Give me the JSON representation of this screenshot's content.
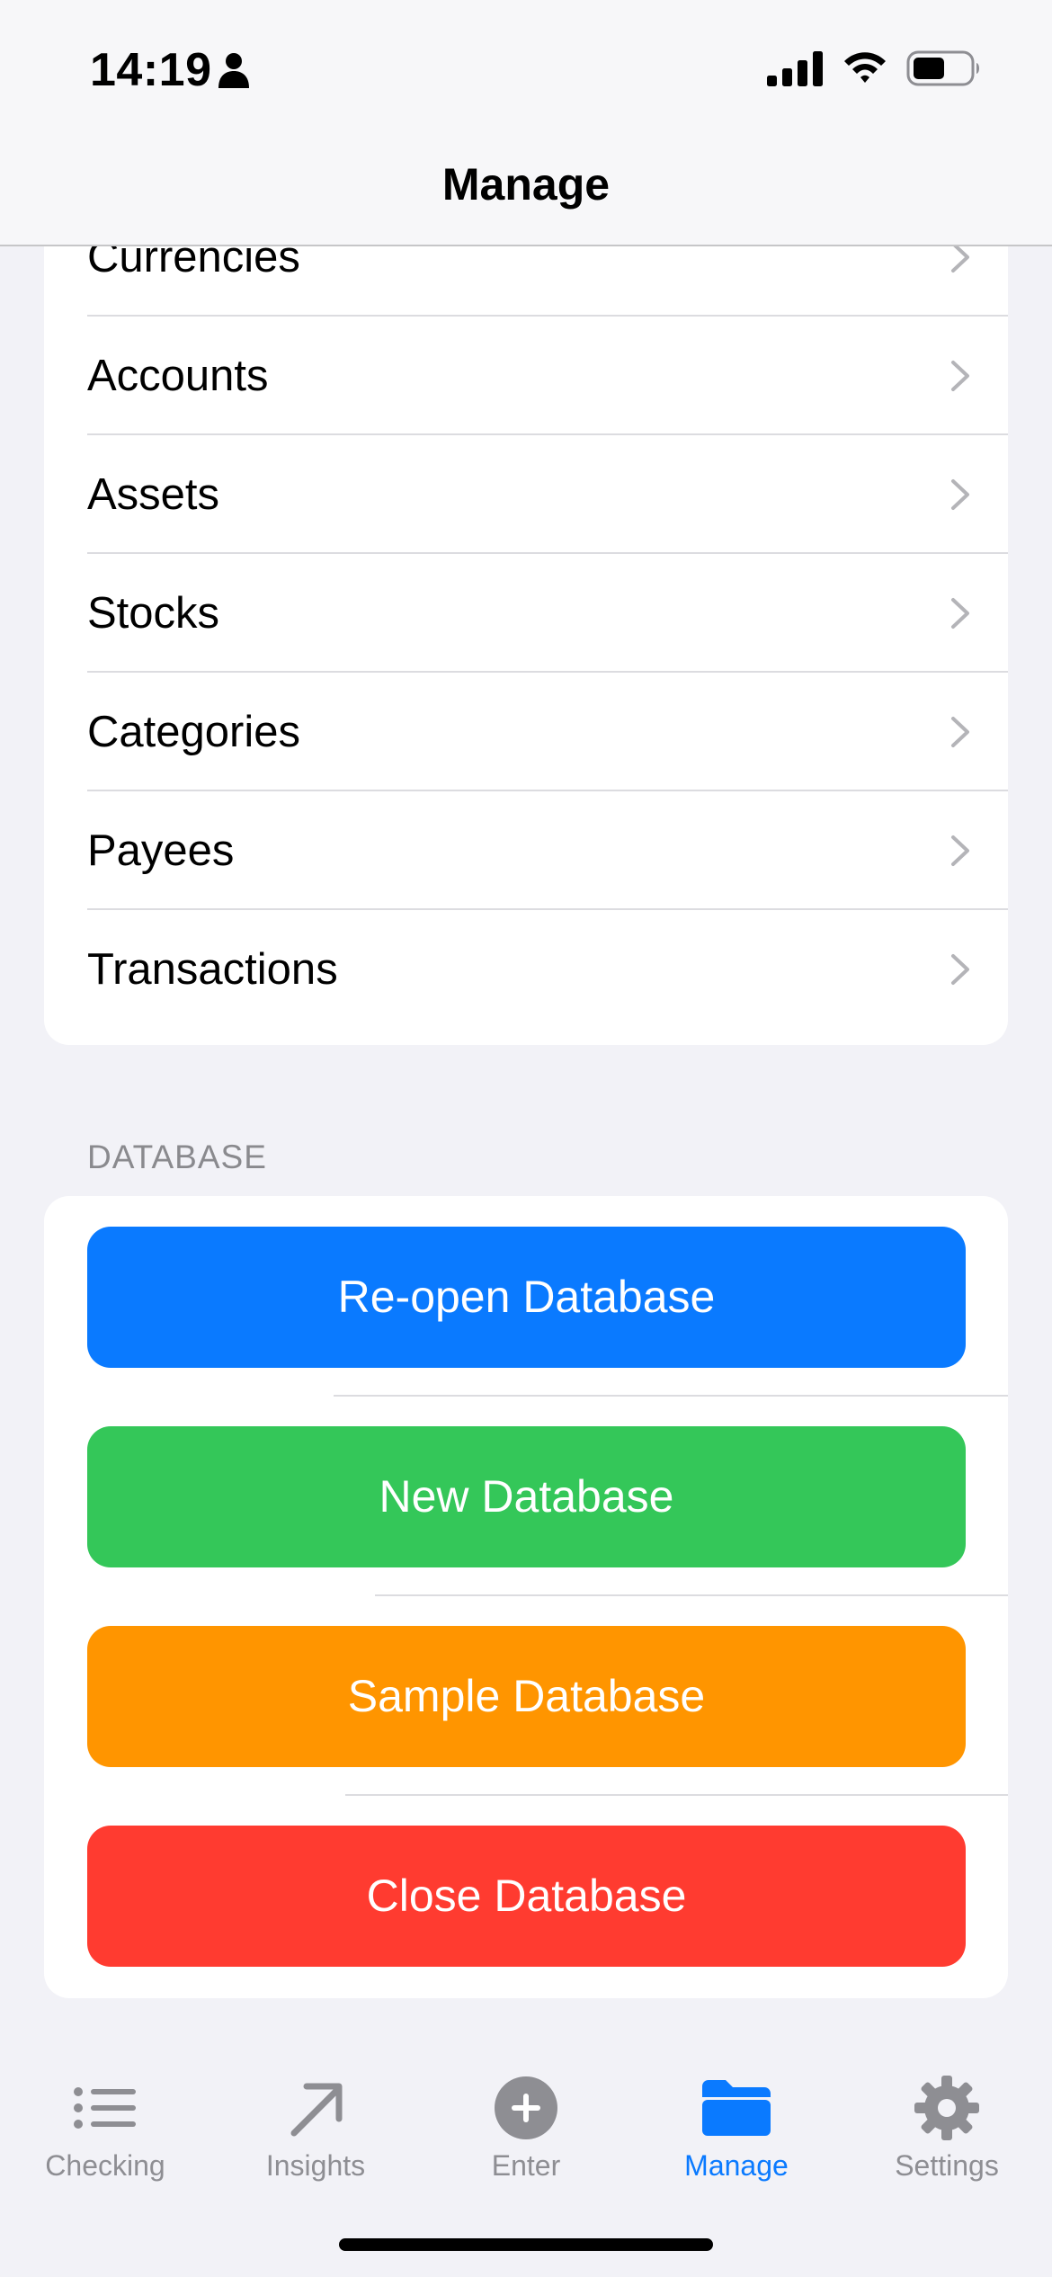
{
  "status_bar": {
    "time": "14:19"
  },
  "nav": {
    "title": "Manage"
  },
  "manage_list": {
    "items": [
      {
        "label": "Currencies"
      },
      {
        "label": "Accounts"
      },
      {
        "label": "Assets"
      },
      {
        "label": "Stocks"
      },
      {
        "label": "Categories"
      },
      {
        "label": "Payees"
      },
      {
        "label": "Transactions"
      }
    ]
  },
  "database": {
    "header": "DATABASE",
    "buttons": [
      {
        "label": "Re-open Database",
        "color": "#0a7aff"
      },
      {
        "label": "New Database",
        "color": "#34c759"
      },
      {
        "label": "Sample Database",
        "color": "#ff9500"
      },
      {
        "label": "Close Database",
        "color": "#ff3b30"
      }
    ]
  },
  "tab_bar": {
    "items": [
      {
        "label": "Checking",
        "icon": "list-icon",
        "active": false
      },
      {
        "label": "Insights",
        "icon": "arrow-up-right-icon",
        "active": false
      },
      {
        "label": "Enter",
        "icon": "plus-circle-icon",
        "active": false
      },
      {
        "label": "Manage",
        "icon": "folder-icon",
        "active": true
      },
      {
        "label": "Settings",
        "icon": "gear-icon",
        "active": false
      }
    ],
    "active_color": "#0a7aff",
    "inactive_color": "#8e8e93"
  }
}
